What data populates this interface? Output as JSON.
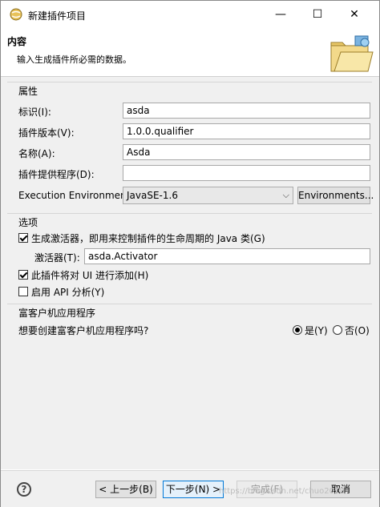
{
  "window": {
    "title": "新建插件项目",
    "minimize": "—",
    "maximize": "☐",
    "close": "✕"
  },
  "banner": {
    "title": "内容",
    "message": "输入生成插件所必需的数据。"
  },
  "properties": {
    "title": "属性",
    "id_label": "标识(I):",
    "id_value": "asda",
    "version_label": "插件版本(V):",
    "version_value": "1.0.0.qualifier",
    "name_label": "名称(A):",
    "name_value": "Asda",
    "provider_label": "插件提供程序(D):",
    "provider_value": "",
    "env_label": "Execution Environment:",
    "env_value": "JavaSE-1.6",
    "env_button": "Environments..."
  },
  "options": {
    "title": "选项",
    "generate_activator": "生成激活器，即用来控制插件的生命周期的 Java 类(G)",
    "generate_activator_checked": true,
    "activator_label": "激活器(T):",
    "activator_value": "asda.Activator",
    "ui_contrib": "此插件将对 UI 进行添加(H)",
    "ui_contrib_checked": true,
    "api_analysis": "启用 API 分析(Y)",
    "api_analysis_checked": false
  },
  "rcp": {
    "title": "富客户机应用程序",
    "question": "想要创建富客户机应用程序吗?",
    "yes": "是(Y)",
    "no": "否(O)",
    "selected": "yes"
  },
  "buttons": {
    "back": "< 上一步(B)",
    "next": "下一步(N) >",
    "finish": "完成(F)",
    "cancel": "取消"
  },
  "watermark": "https://blog.csdn.net/chuo2018"
}
